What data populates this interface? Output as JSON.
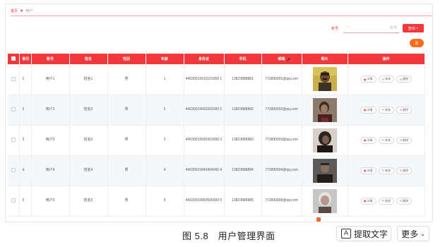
{
  "breadcrumb": {
    "home": "首页",
    "current": "用户"
  },
  "search": {
    "label": "账号",
    "placeholder": "账号",
    "button_label": "查询"
  },
  "add_button_label": "新",
  "table": {
    "headers": [
      "索引",
      "账号",
      "姓名",
      "性别",
      "年龄",
      "身份证",
      "手机",
      "邮箱",
      "照片",
      "操作"
    ],
    "rows": [
      {
        "index": "1",
        "account": "用户1",
        "name": "姓名1",
        "gender": "男",
        "age": "1",
        "idcard": "44030019910101000 1",
        "phone": "13823888881",
        "email": "773890001@qq.com"
      },
      {
        "index": "2",
        "account": "用户2",
        "name": "姓名2",
        "gender": "男",
        "age": "2",
        "idcard": "44030019920202000 2",
        "phone": "13823888882",
        "email": "773890002@qq.com"
      },
      {
        "index": "3",
        "account": "用户3",
        "name": "姓名3",
        "gender": "男",
        "age": "3",
        "idcard": "44030019930303000 3",
        "phone": "13823888883",
        "email": "773890003@qq.com"
      },
      {
        "index": "4",
        "account": "用户4",
        "name": "姓名4",
        "gender": "男",
        "age": "4",
        "idcard": "44030019940404000 4",
        "phone": "13823888884",
        "email": "773890004@qq.com"
      },
      {
        "index": "5",
        "account": "用户5",
        "name": "姓名5",
        "gender": "男",
        "age": "5",
        "idcard": "44030019950505000 5",
        "phone": "13823888885",
        "email": "773890005@qq.com"
      }
    ],
    "actions": {
      "detail": "详情",
      "edit": "修改",
      "delete": "删除"
    }
  },
  "caption": "图 5.8　用户管理界面",
  "toolbar": {
    "extract_label": "提取文字",
    "more_label": "更多"
  },
  "colors": {
    "accent": "#f2383a",
    "add": "#ff6a1a"
  }
}
